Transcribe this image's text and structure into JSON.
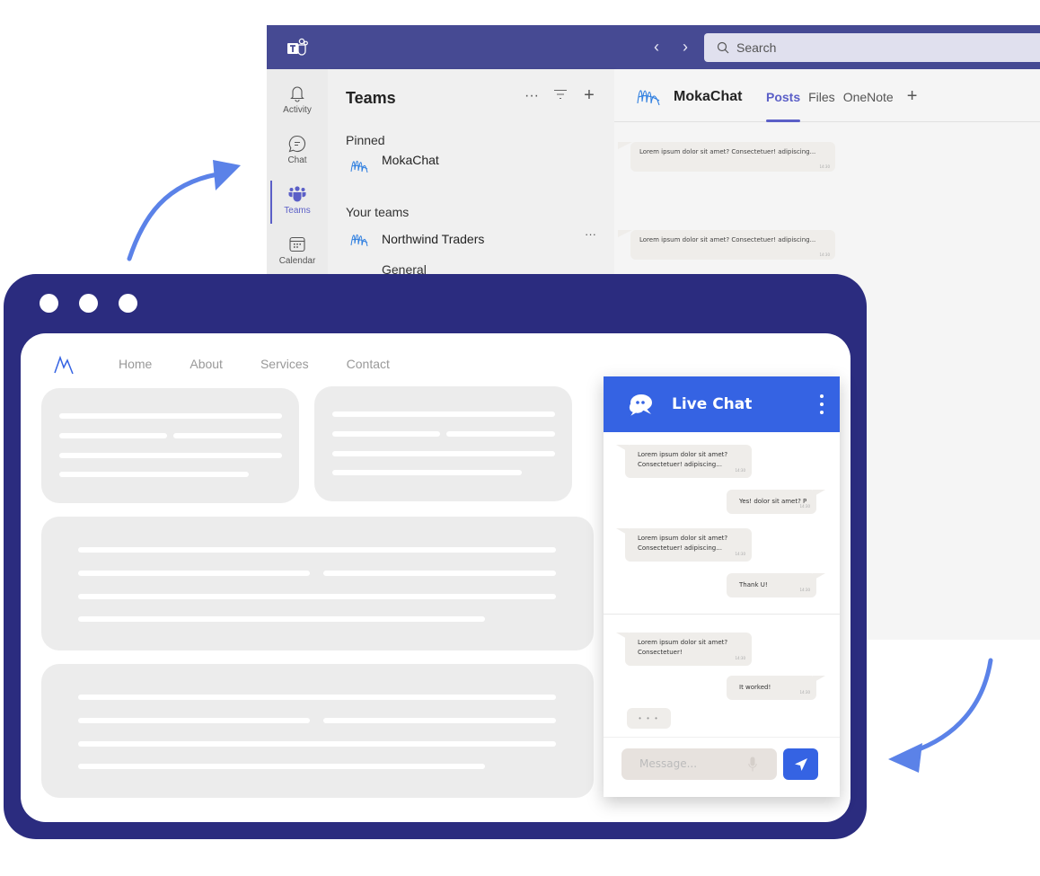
{
  "teams_window": {
    "search_placeholder": "Search",
    "nav_back": "‹",
    "nav_forward": "›",
    "rail": [
      {
        "label": "Activity",
        "icon": "bell-icon"
      },
      {
        "label": "Chat",
        "icon": "chat-icon"
      },
      {
        "label": "Teams",
        "icon": "teams-icon",
        "active": true
      },
      {
        "label": "Calendar",
        "icon": "calendar-icon"
      }
    ],
    "list": {
      "title": "Teams",
      "more": "···",
      "filter": "≡",
      "add": "+",
      "pinned_label": "Pinned",
      "pinned_team": "MokaChat",
      "your_teams_label": "Your teams",
      "team": "Northwind Traders",
      "team_more": "···",
      "channel": "General"
    },
    "main": {
      "team_name": "MokaChat",
      "tabs": [
        {
          "label": "Posts",
          "active": true
        },
        {
          "label": "Files"
        },
        {
          "label": "OneNote"
        }
      ],
      "add_tab": "+",
      "posts": [
        {
          "text": "Lorem ipsum dolor sit amet?    Consectetuer! adipiscing...",
          "time": "14:30"
        },
        {
          "text": "Lorem ipsum dolor sit amet?    Consectetuer! adipiscing...",
          "time": "14:30"
        }
      ]
    }
  },
  "website": {
    "nav": [
      "Home",
      "About",
      "Services",
      "Contact"
    ]
  },
  "live_chat": {
    "title": "Live Chat",
    "messages": [
      {
        "dir": "in",
        "line1": "Lorem ipsum dolor sit amet?",
        "line2": "Consectetuer! adipiscing...",
        "time": "14:30"
      },
      {
        "dir": "out",
        "line1": "Yes! dolor sit amet? P",
        "time": "14:30"
      },
      {
        "dir": "in",
        "line1": "Lorem ipsum dolor sit amet?",
        "line2": "Consectetuer! adipiscing...",
        "time": "14:30"
      },
      {
        "dir": "out",
        "line1": "Thank U!",
        "time": "14:30"
      },
      {
        "dir": "in",
        "line1": "Lorem ipsum dolor sit amet?",
        "line2": "Consectetuer!",
        "time": "14:30"
      },
      {
        "dir": "out",
        "line1": "It worked!",
        "time": "14:30"
      }
    ],
    "typing_indicator": "• • •",
    "message_placeholder": "Message...",
    "colors": {
      "accent": "#3563e3",
      "bubble": "#efedea"
    }
  },
  "colors": {
    "teams_titlebar": "#464a93",
    "teams_accent": "#5b5fc7",
    "browser_frame": "#2b2c7f",
    "arrow": "#5b82e8"
  }
}
